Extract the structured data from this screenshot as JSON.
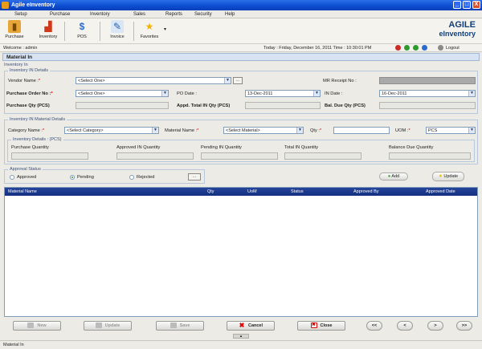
{
  "window": {
    "title": "Agile eInventory",
    "minimize": "_",
    "maximize": "□",
    "close": "X"
  },
  "menu": [
    "Setup",
    "Purchase",
    "Inventory",
    "Sales",
    "Reports",
    "Security",
    "Help"
  ],
  "toolbar": {
    "purchase": "Purchase",
    "inventory": "Inventory",
    "pos": "POS",
    "invoice": "Invoice",
    "favorites": "Favorites",
    "more": "▾"
  },
  "logo": {
    "line1": "AGILE",
    "line2": "eInventory"
  },
  "statusbar": {
    "welcome": "Welcome : admin",
    "datetime": "Today : Friday, December 16, 2011   Time : 10:30:01 PM",
    "logout": "Logout"
  },
  "section_title": "Material In",
  "inventory_in": {
    "legend": "Inventory In",
    "details_legend": "Inventory IN Details",
    "vendor_label": "Vendor Name :",
    "vendor_value": "<Select One>",
    "mr_receipt_label": "MR Receipt No :",
    "mr_receipt_value": "",
    "po_no_label": "Purchase Order No :",
    "po_no_value": "<Select One>",
    "po_date_label": "PO Date :",
    "po_date_value": "13-Dec-2011",
    "in_date_label": "IN Date :",
    "in_date_value": "16-Dec-2011",
    "purchase_qty_label": "Purchase Qty (PCS)",
    "appd_total_label": "Appd. Total IN Qty (PCS)",
    "bal_due_label": "Bal. Due Qty (PCS)"
  },
  "material_details": {
    "legend": "Inventory IN Material Details",
    "category_label": "Category Name :",
    "category_value": "<Select Category>",
    "material_label": "Material Name :",
    "material_value": "<Select Material>",
    "qty_label": "Qty :",
    "qty_value": "",
    "uom_label": "UOM :",
    "uom_value": "PCS",
    "inv_details_legend": "Inventory Details : (PCS)",
    "col_purchase": "Purchase Quantity",
    "col_approved_in": "Approved IN Quantity",
    "col_pending_in": "Pending IN Quantity",
    "col_total_in": "Total IN Quantity",
    "col_balance_due": "Balance Due Quantity"
  },
  "approval": {
    "legend": "Approval Status",
    "approved": "Approved",
    "pending": "Pending",
    "rejected": "Rejected",
    "selected": "pending",
    "ellipsis": "..."
  },
  "actions": {
    "add": "Add",
    "update": "Update"
  },
  "grid": {
    "columns": [
      "Material Name",
      "Qty",
      "UoM",
      "Status",
      "Approved By",
      "Approved Date"
    ],
    "rows": []
  },
  "bottom": {
    "new": "New",
    "update": "Update",
    "save": "Save",
    "cancel": "Cancel",
    "close": "Close",
    "first": "<<",
    "prev": "<",
    "next": ">",
    "last": ">>"
  },
  "footer": {
    "text": "Material In"
  }
}
